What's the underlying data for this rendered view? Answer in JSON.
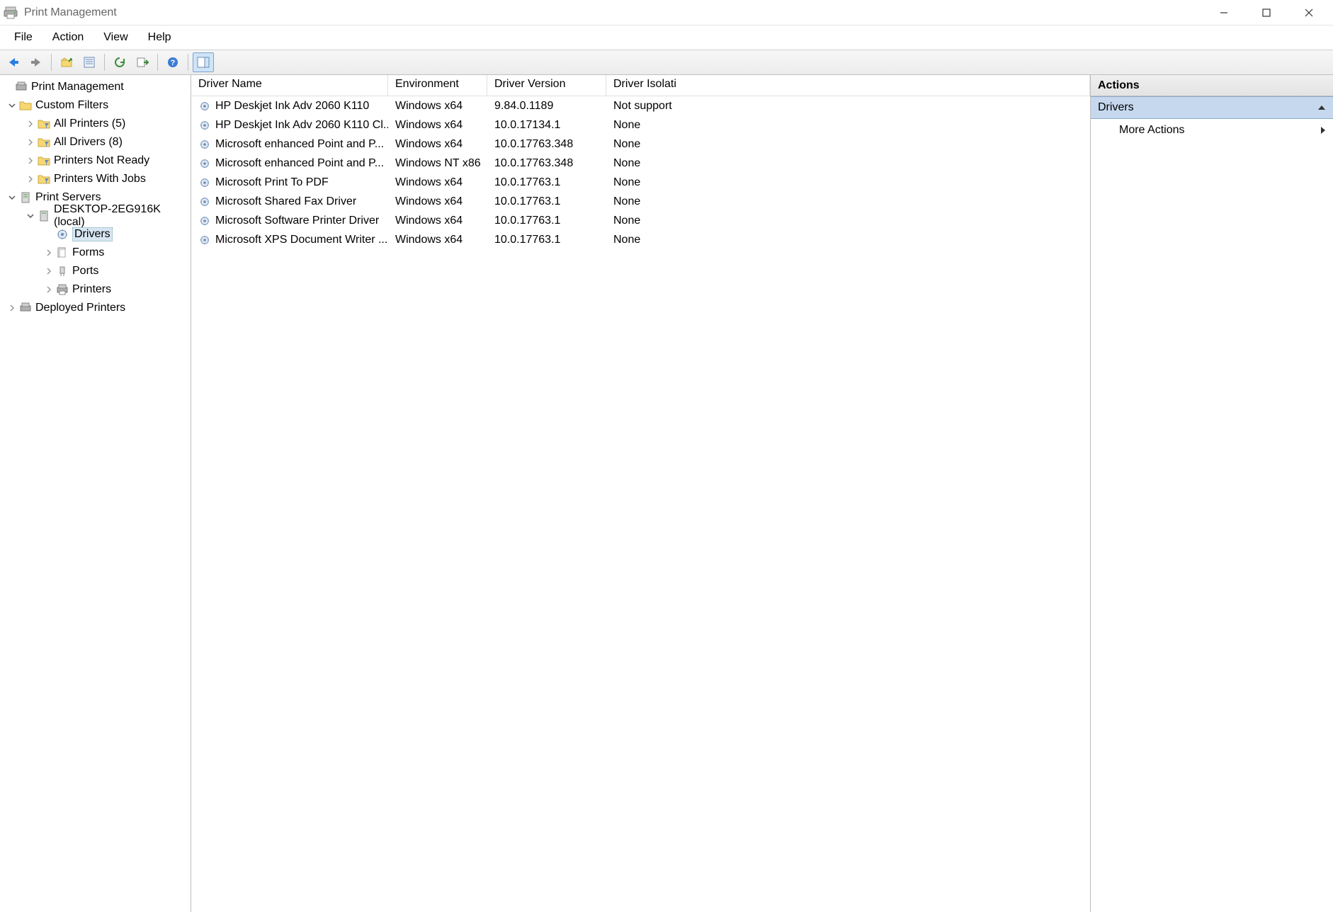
{
  "window": {
    "title": "Print Management"
  },
  "menu": {
    "items": [
      "File",
      "Action",
      "View",
      "Help"
    ]
  },
  "tree": {
    "root": {
      "label": "Print Management"
    },
    "nodes": [
      {
        "label": "Custom Filters",
        "children": [
          {
            "label": "All Printers (5)"
          },
          {
            "label": "All Drivers (8)"
          },
          {
            "label": "Printers Not Ready"
          },
          {
            "label": "Printers With Jobs"
          }
        ]
      },
      {
        "label": "Print Servers",
        "children": [
          {
            "label": "DESKTOP-2EG916K (local)",
            "children": [
              {
                "label": "Drivers",
                "selected": true
              },
              {
                "label": "Forms"
              },
              {
                "label": "Ports"
              },
              {
                "label": "Printers"
              }
            ]
          }
        ]
      },
      {
        "label": "Deployed Printers"
      }
    ]
  },
  "list": {
    "columns": [
      "Driver Name",
      "Environment",
      "Driver Version",
      "Driver Isolati"
    ],
    "rows": [
      {
        "name": "HP Deskjet Ink Adv 2060 K110",
        "env": "Windows x64",
        "ver": "9.84.0.1189",
        "iso": "Not support"
      },
      {
        "name": "HP Deskjet Ink Adv 2060 K110 Cl...",
        "env": "Windows x64",
        "ver": "10.0.17134.1",
        "iso": "None"
      },
      {
        "name": "Microsoft enhanced Point and P...",
        "env": "Windows x64",
        "ver": "10.0.17763.348",
        "iso": "None"
      },
      {
        "name": "Microsoft enhanced Point and P...",
        "env": "Windows NT x86",
        "ver": "10.0.17763.348",
        "iso": "None"
      },
      {
        "name": "Microsoft Print To PDF",
        "env": "Windows x64",
        "ver": "10.0.17763.1",
        "iso": "None"
      },
      {
        "name": "Microsoft Shared Fax Driver",
        "env": "Windows x64",
        "ver": "10.0.17763.1",
        "iso": "None"
      },
      {
        "name": "Microsoft Software Printer Driver",
        "env": "Windows x64",
        "ver": "10.0.17763.1",
        "iso": "None"
      },
      {
        "name": "Microsoft XPS Document Writer ...",
        "env": "Windows x64",
        "ver": "10.0.17763.1",
        "iso": "None"
      }
    ]
  },
  "actions": {
    "header": "Actions",
    "sub": "Drivers",
    "items": [
      "More Actions"
    ]
  }
}
